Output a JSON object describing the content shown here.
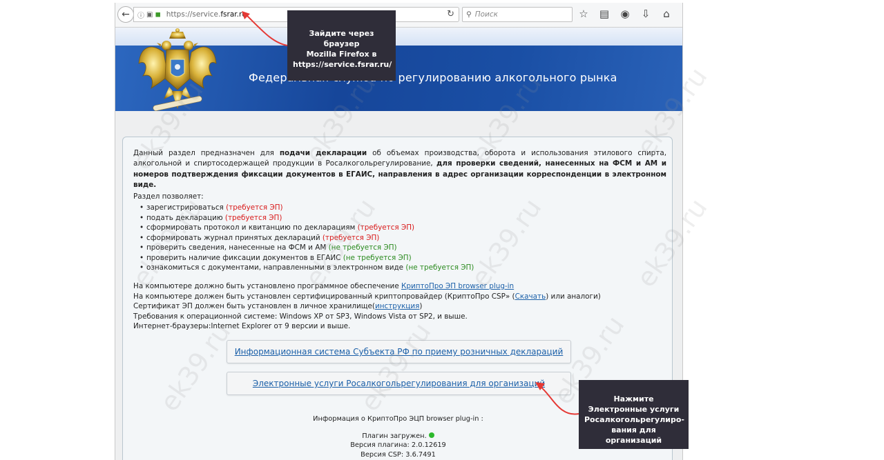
{
  "browser": {
    "url_prefix": "https://service.",
    "url_domain": "fsrar.ru",
    "search_placeholder": "Поиск",
    "icons": [
      "back-arrow-icon",
      "info-icon",
      "camera-icon",
      "lock-icon",
      "reload-icon",
      "search-icon",
      "star-icon",
      "reading-list-icon",
      "pocket-icon",
      "download-icon",
      "home-icon"
    ]
  },
  "header": {
    "title": "Федеральная служба по регулированию алкогольного рынка"
  },
  "intro": {
    "part1": "Данный раздел предназначен для ",
    "part2_bold": "подачи декларации",
    "part3": " об объемах производства, оборота и использования этилового спирта, алкогольной и спиртосодержащей продукции в Росалкогольрегулирование, ",
    "part4_bold": "для проверки сведений, нанесенных на ФСМ и АМ и номеров подтверждения фиксации документов в ЕГАИС, направления в адрес организации корреспонденции в электронном виде."
  },
  "allows_label": "Раздел позволяет:",
  "features": [
    {
      "text": "зарегистрироваться ",
      "note": "(требуется ЭП)",
      "kind": "req"
    },
    {
      "text": "подать декларацию ",
      "note": "(требуется ЭП)",
      "kind": "req"
    },
    {
      "text": "сформировать протокол и квитанцию по декларациям ",
      "note": "(требуется ЭП)",
      "kind": "req"
    },
    {
      "text": "сформировать журнал принятых деклараций ",
      "note": "(требуется ЭП)",
      "kind": "req"
    },
    {
      "text": "проверить сведения, нанесенные на ФСМ и АМ ",
      "note": "(не требуется ЭП)",
      "kind": "noreq"
    },
    {
      "text": "проверить наличие фиксации документов в ЕГАИС ",
      "note": "(не требуется ЭП)",
      "kind": "noreq"
    },
    {
      "text": "ознакомиться с документами, направленными в электронном виде ",
      "note": "(не требуется ЭП)",
      "kind": "noreq"
    }
  ],
  "software": {
    "line1_text": "На компьютере должно быть установлено программное обеспечение ",
    "line1_link": "КриптоПро ЭП browser plug-in",
    "line2_text": "На компьютере должен быть установлен сертифицированный криптопровайдер (КриптоПро CSP» (",
    "line2_link": "Скачать",
    "line2_tail": ") или аналоги)",
    "line3_text": "Сертификат ЭП должен быть установлен в личное хранилище(",
    "line3_link": "инструкция",
    "line3_tail": ")",
    "line4": "Требования к операционной системе: Windows XP от SP3, Windows Vista от SP2, и выше.",
    "line5": "Интернет-браузеры:Internet Explorer от 9 версии и выше."
  },
  "buttons": {
    "regional": "Информационная система Субъекта РФ по приему розничных деклараций",
    "eservices": "Электронные услуги Росалкогольрегулирования для организаций"
  },
  "plugin": {
    "title": "Информация о КриптоПро ЭЦП browser plug-in :",
    "loaded": "Плагин загружен.",
    "plugin_version": "Версия плагина: 2.0.12619",
    "csp_version": "Версия CSP: 3.6.7491",
    "status_color": "#2db92d"
  },
  "watermark": "ek39.ru",
  "callouts": {
    "first": [
      "Зайдите через браузер",
      "Mozilla  Firefox в",
      "https://service.fsrar.ru/"
    ],
    "second": [
      "Нажмите",
      "Электронные  услуги",
      "Росалкогольрегулиро-",
      "вания для организаций"
    ]
  },
  "colors": {
    "arrow": "#e53935",
    "callout_bg": "#2f2d39",
    "link": "#1a5fa8",
    "required": "#d91a1a",
    "not_required": "#2a8a1e"
  }
}
